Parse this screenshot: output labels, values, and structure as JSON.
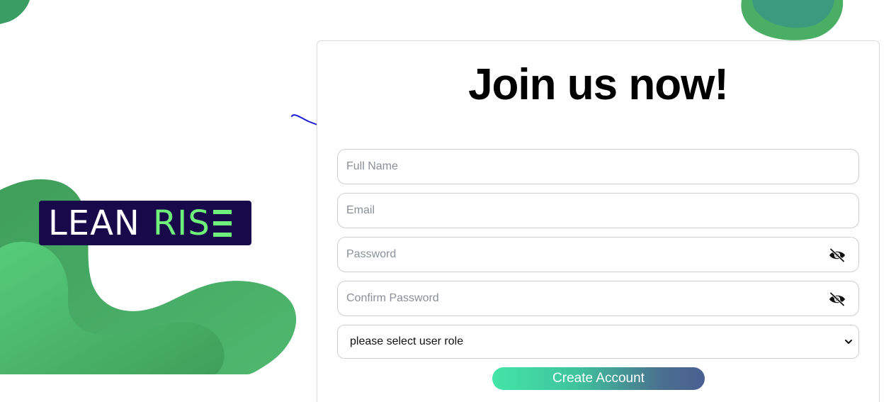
{
  "logo": {
    "word1": "LEAN",
    "word2": "RIS"
  },
  "form": {
    "title": "Join us now!",
    "full_name": {
      "placeholder": "Full Name",
      "value": ""
    },
    "email": {
      "placeholder": "Email",
      "value": ""
    },
    "password": {
      "placeholder": "Password",
      "value": "",
      "toggle_icon": "eye-slash-icon"
    },
    "confirm_password": {
      "placeholder": "Confirm Password",
      "value": "",
      "toggle_icon": "eye-slash-icon"
    },
    "role_select": {
      "selected": "please select user role"
    },
    "submit_label": "Create Account"
  },
  "colors": {
    "brand_green": "#47b36b",
    "logo_background": "#180a4a",
    "logo_accent": "#6ff07b",
    "button_gradient_start": "#43e5a8",
    "button_gradient_end": "#4a5f91"
  }
}
